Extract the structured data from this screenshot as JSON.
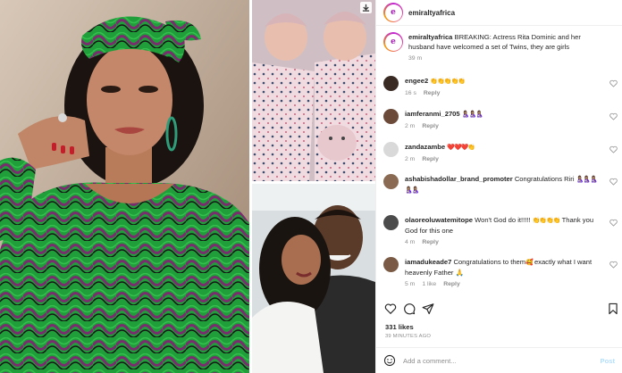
{
  "header": {
    "username": "emiraltyafrica"
  },
  "caption": {
    "username": "emiraltyafrica",
    "text": "BREAKING: Actress Rita Dominic and her husband have welcomed a set of Twins, they are girls",
    "time": "39 m"
  },
  "comments": [
    {
      "username": "engee2",
      "text": "",
      "emoji": "👏👏👏👏👏",
      "time": "16 s",
      "likes": "",
      "reply": "Reply",
      "avatar_color": "#3a2a24"
    },
    {
      "username": "iamferanmi_2705",
      "text": "",
      "emoji": "🤱🏽🤱🏽🤱🏽",
      "time": "2 m",
      "likes": "",
      "reply": "Reply",
      "avatar_color": "#6b4a3a"
    },
    {
      "username": "zandazambe",
      "text": "",
      "emoji": "❤️❤️❤️👏",
      "time": "2 m",
      "likes": "",
      "reply": "Reply",
      "avatar_color": "#d9d9d9"
    },
    {
      "username": "ashabishadollar_brand_promoter",
      "text": "Congratulations Riri",
      "emoji": "🤱🏽🤱🏽🤱🏽🤱🏽🤱🏽",
      "time": "",
      "likes": "",
      "reply": "",
      "avatar_color": "#8a6a52"
    },
    {
      "username": "olaoreoluwatemitope",
      "text": "Won't God do it!!!!!",
      "emoji": "👏👏👏👏",
      "text2": "Thank you God for this one",
      "time": "4 m",
      "likes": "",
      "reply": "Reply",
      "avatar_color": "#4b4b4b"
    },
    {
      "username": "iamadukeade7",
      "text": "Congratulations to them",
      "emoji": "🥰",
      "text2": "exactly what I want heavenly Father 🙏",
      "time": "5 m",
      "likes": "1 like",
      "reply": "Reply",
      "avatar_color": "#7a5a44"
    }
  ],
  "actions": {
    "like": "heart-outline",
    "comment": "comment-bubble",
    "share": "paper-plane",
    "save": "bookmark"
  },
  "likes_count": "331 likes",
  "time_ago": "39 MINUTES AGO",
  "add_comment": {
    "placeholder": "Add a comment...",
    "post_label": "Post"
  },
  "colors": {
    "accent_post": "#b2dffc",
    "secondary_text": "#8e8e8e",
    "border": "#efefef"
  }
}
